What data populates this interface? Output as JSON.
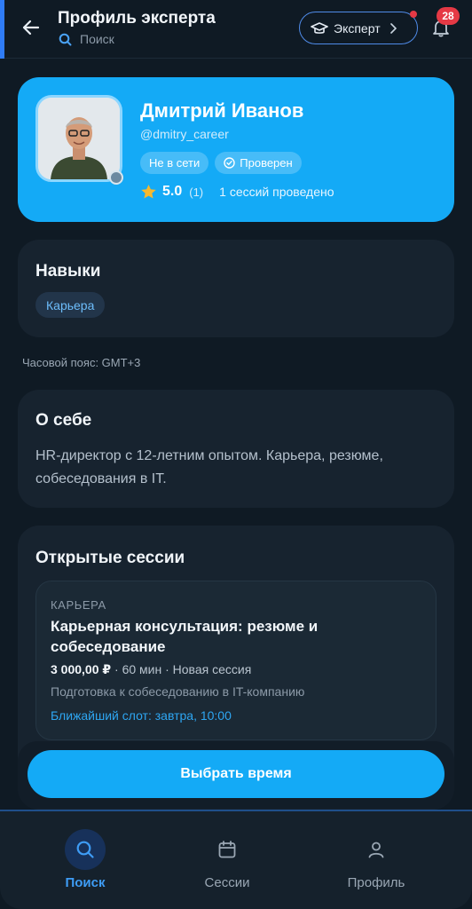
{
  "header": {
    "title": "Профиль эксперта",
    "search_label": "Поиск",
    "expert_button": "Эксперт",
    "notification_count": "28"
  },
  "profile": {
    "name": "Дмитрий Иванов",
    "handle": "@dmitry_career",
    "status": "Не в сети",
    "verified": "Проверен",
    "rating": "5.0",
    "rating_count": "(1)",
    "sessions_done": "1 сессий проведено"
  },
  "skills": {
    "title": "Навыки",
    "items": [
      "Карьера"
    ]
  },
  "timezone": "Часовой пояс: GMT+3",
  "about": {
    "title": "О себе",
    "text": "HR-директор с 12-летним опытом. Карьера, резюме, собеседования в IT."
  },
  "sessions": {
    "title": "Открытые сессии",
    "items": [
      {
        "category": "КАРЬЕРА",
        "title": "Карьерная консультация: резюме и собеседование",
        "price": "3 000,00 ₽",
        "meta_rest": " · 60 мин · Новая сессия",
        "description": "Подготовка к собеседованию в IT-компанию",
        "slot": "Ближайший слот: завтра, 10:00"
      }
    ]
  },
  "cta": "Выбрать время",
  "nav": [
    {
      "label": "Поиск",
      "icon": "search-icon",
      "active": true
    },
    {
      "label": "Сессии",
      "icon": "calendar-icon",
      "active": false
    },
    {
      "label": "Профиль",
      "icon": "user-icon",
      "active": false
    }
  ],
  "colors": {
    "accent": "#14aaf6",
    "background": "#0f1a24",
    "card": "#17232f",
    "badge": "#e53945"
  }
}
